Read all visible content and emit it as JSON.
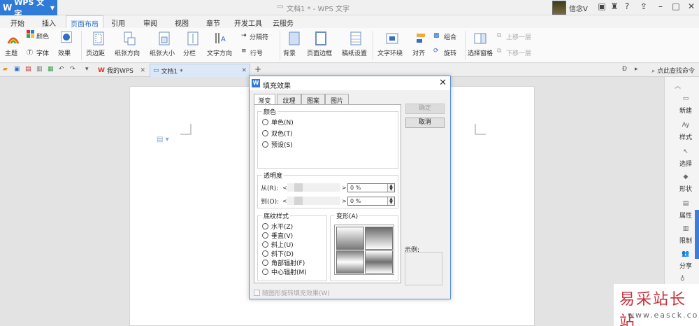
{
  "app": {
    "name": "WPS 文字",
    "logo": "W",
    "doc_title": "文档1 * - WPS 文字",
    "user": "信念V"
  },
  "ribbon_tabs": [
    "开始",
    "插入",
    "页面布局",
    "引用",
    "审阅",
    "视图",
    "章节",
    "开发工具",
    "云服务"
  ],
  "ribbon": {
    "theme": "主题",
    "color": "颜色",
    "font": "字体",
    "effect": "效果",
    "margin": "页边距",
    "orientation": "纸张方向",
    "size": "纸张大小",
    "columns": "分栏",
    "text_dir": "文字方向",
    "separator": "分隔符",
    "line_num": "行号",
    "background": "背景",
    "page_border": "页面边框",
    "grid": "稿纸设置",
    "wrap": "文字环绕",
    "align": "对齐",
    "group": "组合",
    "rotate": "旋转",
    "select_pane": "选择窗格",
    "move_up": "上移一层",
    "move_down": "下移一层"
  },
  "doc_tabs": {
    "home": "我的WPS",
    "doc": "文档1 *",
    "search": "点此查找命令"
  },
  "right_panel": [
    "新建",
    "样式",
    "选择",
    "形状",
    "属性",
    "限制",
    "分享"
  ],
  "dialog": {
    "title": "填充效果",
    "tabs": [
      "渐变",
      "纹理",
      "图案",
      "图片"
    ],
    "color_group": "颜色",
    "color_options": [
      "单色(N)",
      "双色(T)",
      "预设(S)"
    ],
    "transparency_group": "透明度",
    "from_label": "从(R):",
    "to_label": "到(O):",
    "from_value": "0 %",
    "to_value": "0 %",
    "shading_group": "底纹样式",
    "shading_options": [
      "水平(Z)",
      "垂直(V)",
      "斜上(U)",
      "斜下(D)",
      "角部辐射(F)",
      "中心辐射(M)"
    ],
    "variant_group": "变形(A)",
    "ok": "确定",
    "cancel": "取消",
    "sample": "示例:",
    "rotate_with_shape": "随图形旋转填充效果(W)"
  },
  "watermark": {
    "main": "易采站长站",
    "sub": "www.easck.com"
  },
  "colors": {
    "accent": "#2f7bd8",
    "dialog_border": "#5c92d6",
    "watermark": "#c9313a"
  }
}
